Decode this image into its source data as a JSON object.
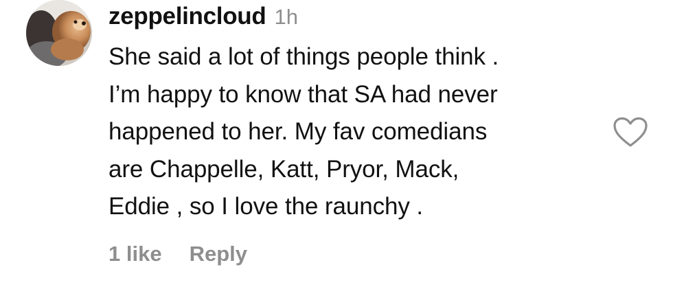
{
  "comment": {
    "username": "zeppelincloud",
    "timestamp": "1h",
    "text_lines": [
      "She said a lot of things people think .",
      "I’m happy to know that SA had never",
      "happened to her. My fav comedians",
      "are Chappelle, Katt, Pryor, Mack,",
      "Eddie , so I love the raunchy ."
    ],
    "likes_label": "1 like",
    "reply_label": "Reply"
  },
  "icons": {
    "like": "heart-outline-icon",
    "avatar": "user-avatar-dog-photo"
  },
  "colors": {
    "text": "#111111",
    "secondary": "#8e8e8e",
    "background": "#ffffff"
  }
}
